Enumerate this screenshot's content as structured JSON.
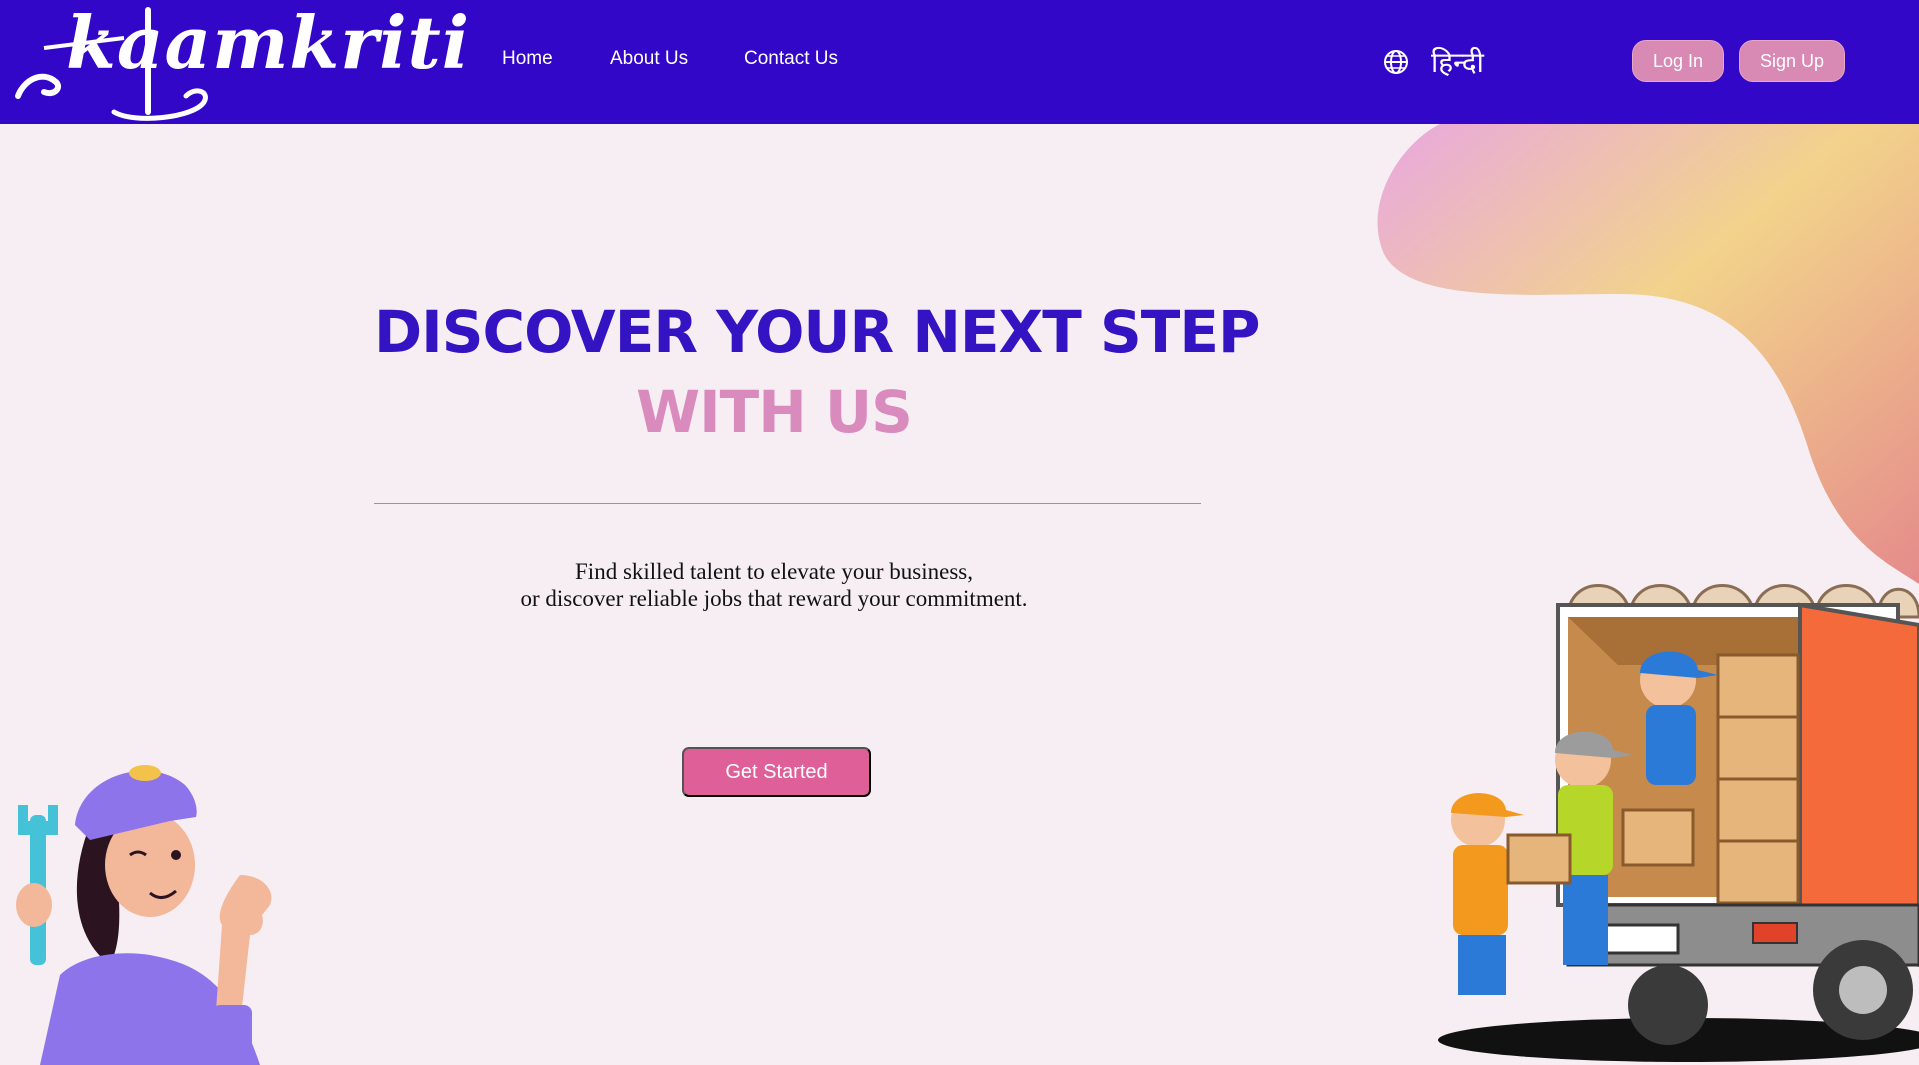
{
  "brand": {
    "logo_text": "kaamkriti"
  },
  "nav": {
    "home": "Home",
    "about": "About Us",
    "contact": "Contact Us"
  },
  "language": {
    "label": "हिन्दी",
    "icon": "globe-icon"
  },
  "auth": {
    "login": "Log In",
    "signup": "Sign Up"
  },
  "hero": {
    "title_line1": "DISCOVER YOUR NEXT STEP",
    "title_line2": "WITH US",
    "subtitle_line1": "Find skilled talent to elevate your business,",
    "subtitle_line2": "or discover reliable jobs that reward your commitment.",
    "cta": "Get Started"
  },
  "colors": {
    "header_bg": "#3307c8",
    "page_bg": "#f6eef2",
    "title_primary": "#3413c2",
    "title_accent": "#d98bbd",
    "cta_bg": "#df5f98",
    "pill_bg": "#d889b4"
  }
}
